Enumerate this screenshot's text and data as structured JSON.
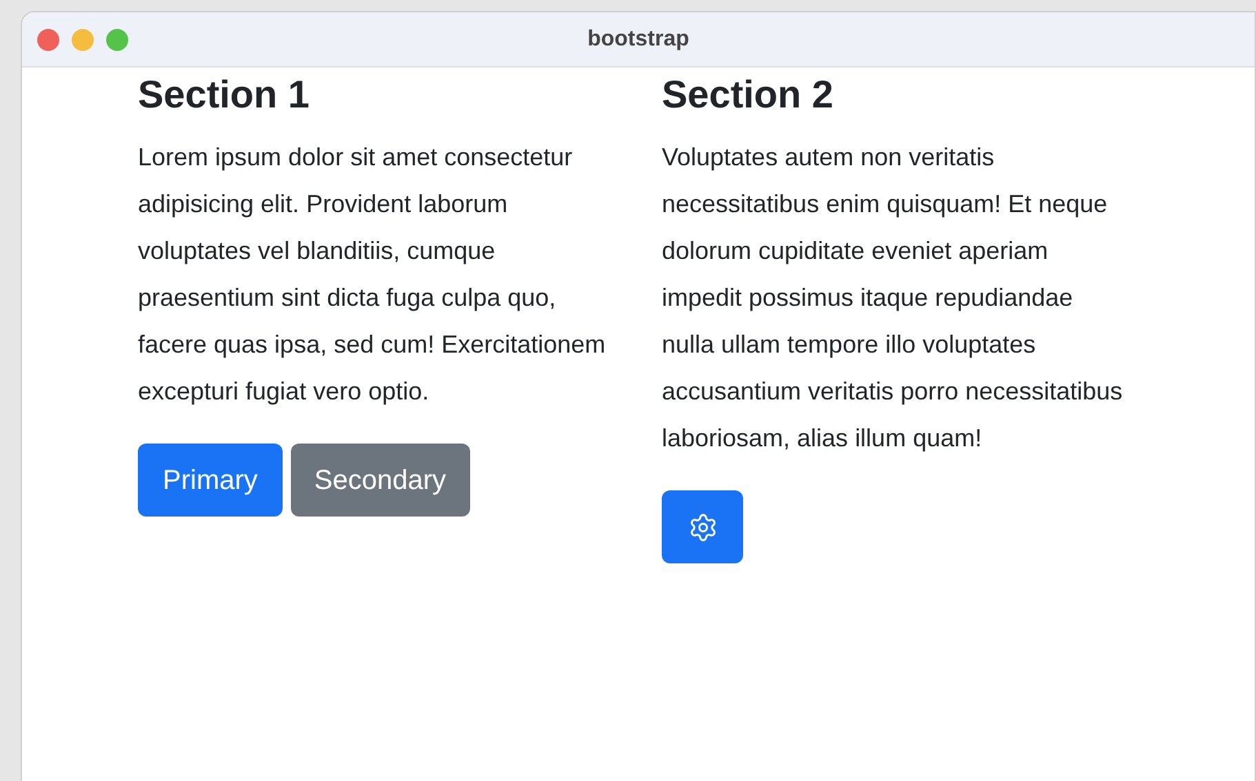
{
  "window": {
    "title": "bootstrap"
  },
  "sections": [
    {
      "heading": "Section 1",
      "text": "Lorem ipsum dolor sit amet consectetur adipisicing elit. Provident laborum voluptates vel blanditiis, cumque praesentium sint dicta fuga culpa quo, facere quas ipsa, sed cum! Exercitationem excepturi fugiat vero optio.",
      "buttons": [
        {
          "kind": "primary",
          "label": "Primary"
        },
        {
          "kind": "secondary",
          "label": "Secondary"
        }
      ]
    },
    {
      "heading": "Section 2",
      "text": "Voluptates autem non veritatis necessitatibus enim quisquam! Et neque dolorum cupiditate eveniet aperiam impedit possimus itaque repudiandae nulla ullam tempore illo voluptates accusantium veritatis porro necessitatibus laboriosam, alias illum quam!",
      "buttons": [
        {
          "kind": "icon"
        }
      ]
    }
  ]
}
